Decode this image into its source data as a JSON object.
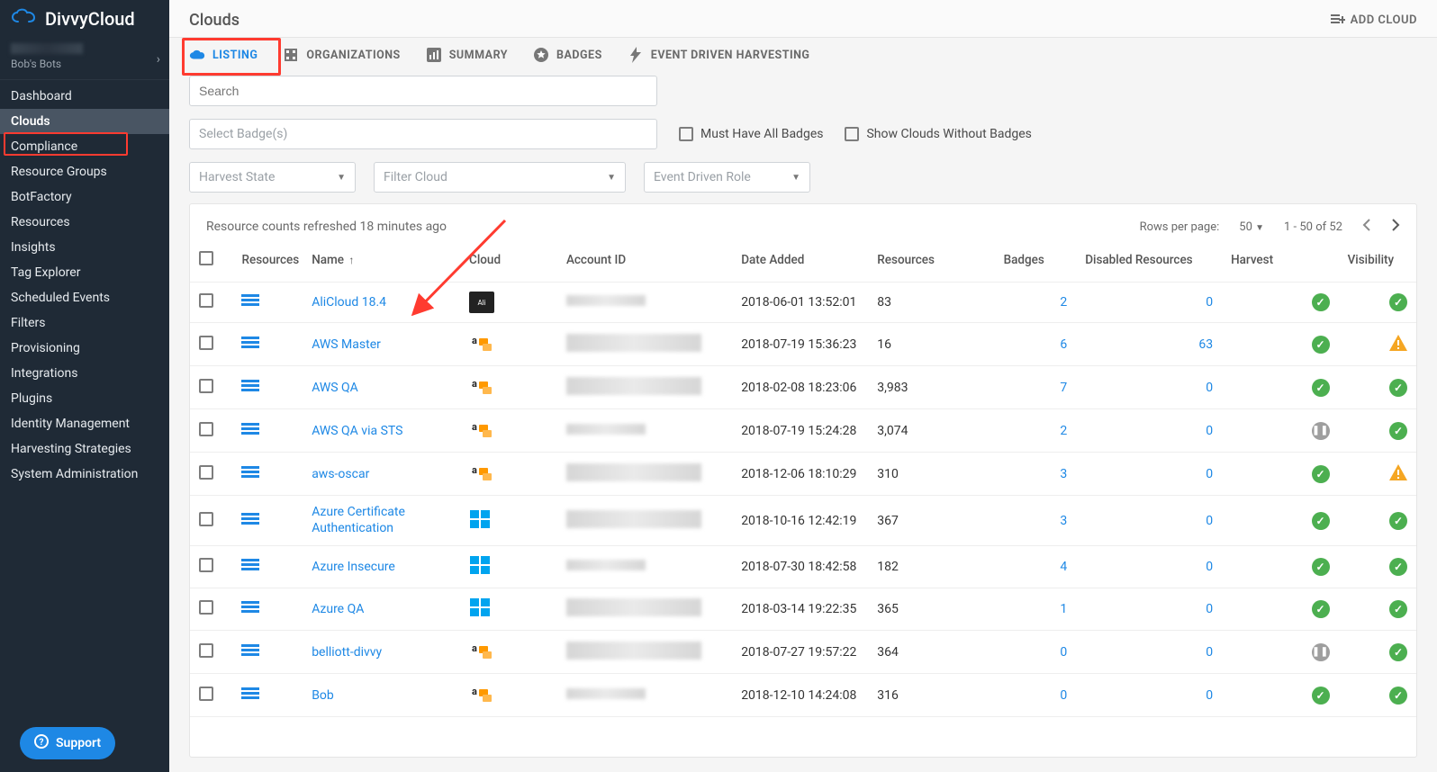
{
  "app": {
    "name": "DivvyCloud"
  },
  "user": {
    "org": "Bob's Bots"
  },
  "sidebar": {
    "items": [
      {
        "label": "Dashboard"
      },
      {
        "label": "Clouds"
      },
      {
        "label": "Compliance"
      },
      {
        "label": "Resource Groups"
      },
      {
        "label": "BotFactory"
      },
      {
        "label": "Resources"
      },
      {
        "label": "Insights"
      },
      {
        "label": "Tag Explorer"
      },
      {
        "label": "Scheduled Events"
      },
      {
        "label": "Filters"
      },
      {
        "label": "Provisioning"
      },
      {
        "label": "Integrations"
      },
      {
        "label": "Plugins"
      },
      {
        "label": "Identity Management"
      },
      {
        "label": "Harvesting Strategies"
      },
      {
        "label": "System Administration"
      }
    ],
    "active_index": 1
  },
  "support": {
    "label": "Support"
  },
  "page": {
    "title": "Clouds",
    "add_cloud": "ADD CLOUD"
  },
  "tabs": {
    "listing": "LISTING",
    "organizations": "ORGANIZATIONS",
    "summary": "SUMMARY",
    "badges": "BADGES",
    "edh": "EVENT DRIVEN HARVESTING"
  },
  "filters": {
    "search_placeholder": "Search",
    "badges_placeholder": "Select Badge(s)",
    "must_have_all": "Must Have All Badges",
    "no_badges": "Show Clouds Without Badges",
    "harvest_state": "Harvest State",
    "filter_cloud": "Filter Cloud",
    "event_driven_role": "Event Driven Role"
  },
  "table": {
    "refreshed": "Resource counts refreshed 18 minutes ago",
    "pager": {
      "rpp_label": "Rows per page:",
      "rpp_value": "50",
      "range": "1 - 50 of 52"
    },
    "columns": {
      "resources_ico": "Resources",
      "name": "Name",
      "cloud": "Cloud",
      "account_id": "Account ID",
      "date_added": "Date Added",
      "resources": "Resources",
      "badges": "Badges",
      "disabled": "Disabled Resources",
      "harvest": "Harvest",
      "visibility": "Visibility"
    },
    "rows": [
      {
        "name": "AliCloud 18.4",
        "cloud": "ali",
        "date": "2018-06-01 13:52:01",
        "resources": "83",
        "badges": "2",
        "disabled": "0",
        "harvest": "ok",
        "visibility": "ok"
      },
      {
        "name": "AWS Master",
        "cloud": "aws",
        "date": "2018-07-19 15:36:23",
        "resources": "16",
        "badges": "6",
        "disabled": "63",
        "harvest": "ok",
        "visibility": "warn"
      },
      {
        "name": "AWS QA",
        "cloud": "aws",
        "date": "2018-02-08 18:23:06",
        "resources": "3,983",
        "badges": "7",
        "disabled": "0",
        "harvest": "ok",
        "visibility": "ok"
      },
      {
        "name": "AWS QA via STS",
        "cloud": "aws",
        "date": "2018-07-19 15:24:28",
        "resources": "3,074",
        "badges": "2",
        "disabled": "0",
        "harvest": "pause",
        "visibility": "ok"
      },
      {
        "name": "aws-oscar",
        "cloud": "aws",
        "date": "2018-12-06 18:10:29",
        "resources": "310",
        "badges": "3",
        "disabled": "0",
        "harvest": "ok",
        "visibility": "warn"
      },
      {
        "name": "Azure Certificate Authentication",
        "cloud": "azure",
        "date": "2018-10-16 12:42:19",
        "resources": "367",
        "badges": "3",
        "disabled": "0",
        "harvest": "ok",
        "visibility": "ok",
        "wrap": true
      },
      {
        "name": "Azure Insecure",
        "cloud": "azure",
        "date": "2018-07-30 18:42:58",
        "resources": "182",
        "badges": "4",
        "disabled": "0",
        "harvest": "ok",
        "visibility": "ok"
      },
      {
        "name": "Azure QA",
        "cloud": "azure",
        "date": "2018-03-14 19:22:35",
        "resources": "365",
        "badges": "1",
        "disabled": "0",
        "harvest": "ok",
        "visibility": "ok"
      },
      {
        "name": "belliott-divvy",
        "cloud": "aws",
        "date": "2018-07-27 19:57:22",
        "resources": "364",
        "badges": "0",
        "disabled": "0",
        "harvest": "pause",
        "visibility": "ok"
      },
      {
        "name": "Bob",
        "cloud": "aws",
        "date": "2018-12-10 14:24:08",
        "resources": "316",
        "badges": "0",
        "disabled": "0",
        "harvest": "ok",
        "visibility": "ok"
      }
    ]
  }
}
